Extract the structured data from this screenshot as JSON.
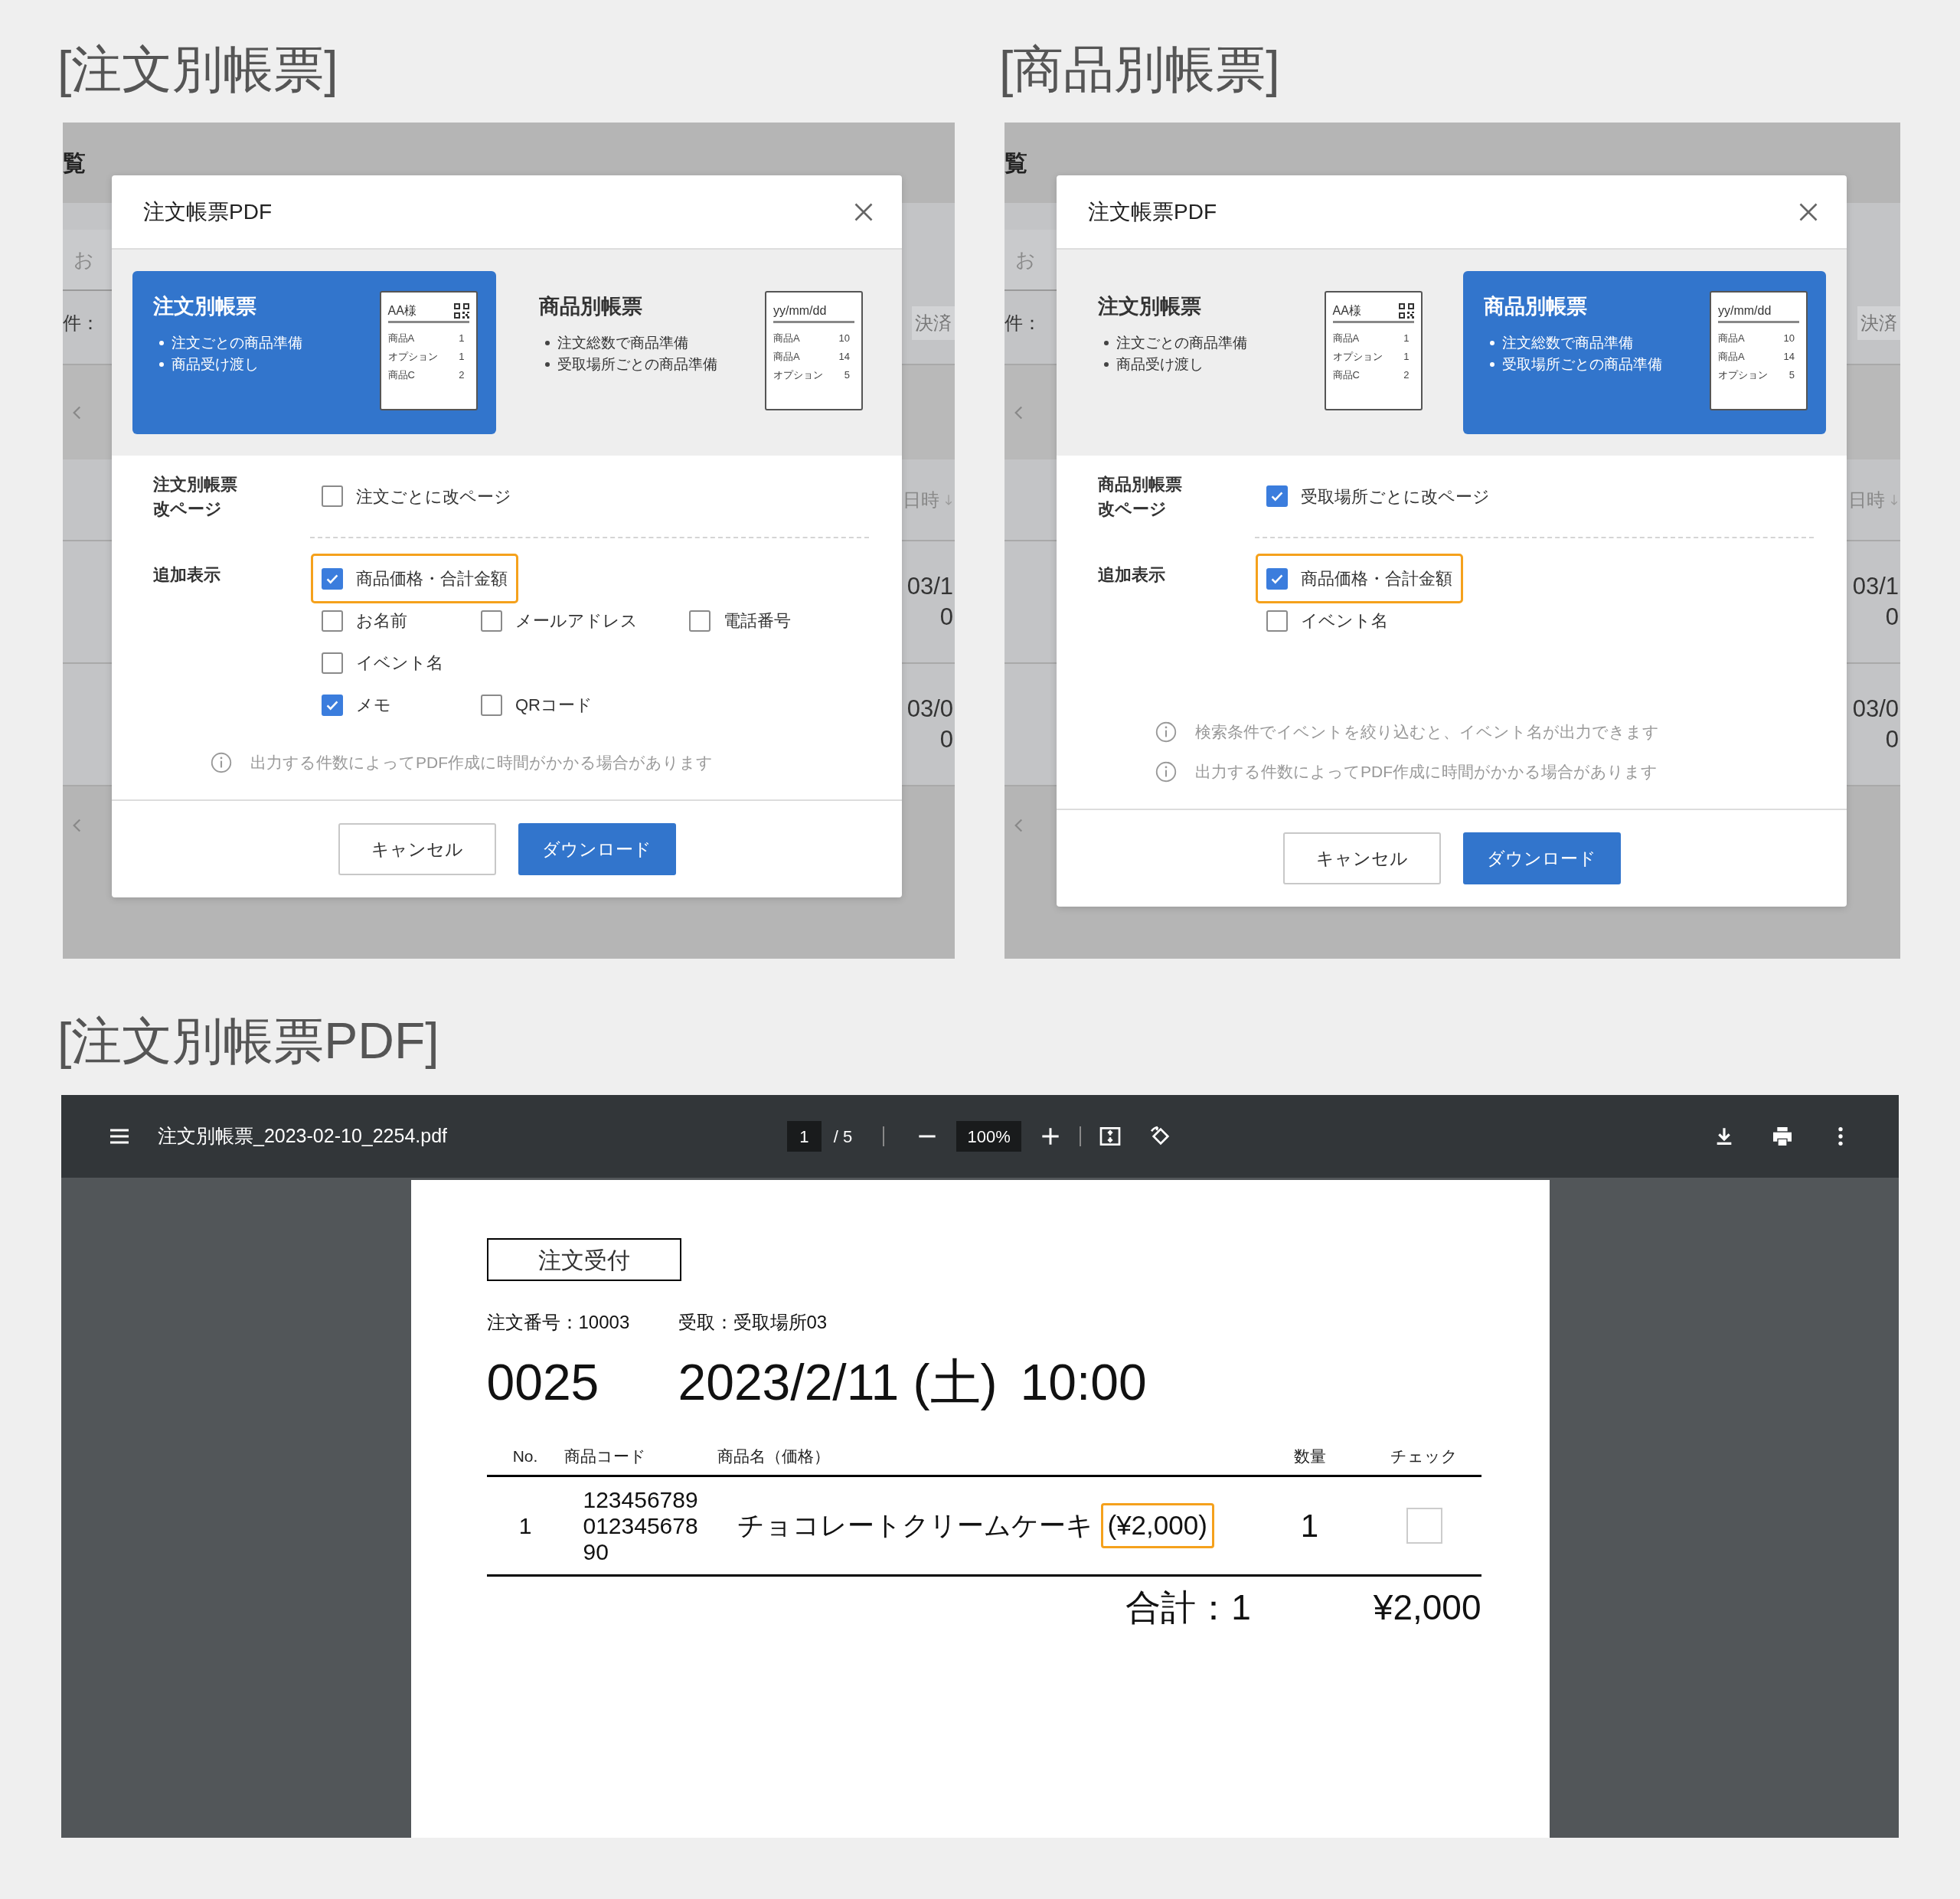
{
  "sections": [
    {
      "title": "[注文別帳票]",
      "backdrop": {
        "heading": "覧",
        "search_placeholder": "お",
        "filter_label": "件：",
        "filter_chip": "決済",
        "column_header": "日時",
        "rows": [
          [
            "03/1",
            "0"
          ],
          [
            "03/0",
            "0"
          ]
        ]
      },
      "dialog": {
        "title": "注文帳票PDF",
        "cards": [
          {
            "title": "注文別帳票",
            "selected": true,
            "bullets": [
              "注文ごとの商品準備",
              "商品受け渡し"
            ],
            "thumbnail": {
              "heading": "AA様",
              "kind": "order",
              "rows": [
                [
                  "商品A",
                  "1"
                ],
                [
                  "オプション",
                  "1"
                ],
                [
                  "商品C",
                  "2"
                ]
              ]
            }
          },
          {
            "title": "商品別帳票",
            "selected": false,
            "bullets": [
              "注文総数で商品準備",
              "受取場所ごとの商品準備"
            ],
            "thumbnail": {
              "heading": "yy/mm/dd",
              "kind": "product",
              "rows": [
                [
                  "商品A",
                  "10"
                ],
                [
                  "商品A",
                  "14"
                ],
                [
                  "オプション",
                  "5"
                ]
              ]
            }
          }
        ],
        "page_break": {
          "label": [
            "注文別帳票",
            "改ページ"
          ],
          "option": {
            "label": "注文ごとに改ページ",
            "checked": false
          }
        },
        "extra": {
          "label": "追加表示",
          "rows": [
            [
              {
                "label": "商品価格・合計金額",
                "checked": true,
                "highlighted": true
              }
            ],
            [
              {
                "label": "お名前",
                "checked": false,
                "highlighted": false
              },
              {
                "label": "メールアドレス",
                "checked": false,
                "highlighted": false
              },
              {
                "label": "電話番号",
                "checked": false,
                "highlighted": false
              }
            ],
            [
              {
                "label": "イベント名",
                "checked": false,
                "highlighted": false
              }
            ],
            [
              {
                "label": "メモ",
                "checked": true,
                "highlighted": false
              },
              {
                "label": "QRコード",
                "checked": false,
                "highlighted": false
              }
            ]
          ]
        },
        "notes": [
          "出力する件数によってPDF作成に時間がかかる場合があります"
        ],
        "buttons": [
          {
            "label": "キャンセル",
            "kind": "secondary"
          },
          {
            "label": "ダウンロード",
            "kind": "primary"
          }
        ]
      }
    },
    {
      "title": "[商品別帳票]",
      "backdrop": {
        "heading": "覧",
        "search_placeholder": "お",
        "filter_label": "件：",
        "filter_chip": "決済",
        "column_header": "日時",
        "rows": [
          [
            "03/1",
            "0"
          ],
          [
            "03/0",
            "0"
          ]
        ]
      },
      "dialog": {
        "title": "注文帳票PDF",
        "cards": [
          {
            "title": "注文別帳票",
            "selected": false,
            "bullets": [
              "注文ごとの商品準備",
              "商品受け渡し"
            ],
            "thumbnail": {
              "heading": "AA様",
              "kind": "order",
              "rows": [
                [
                  "商品A",
                  "1"
                ],
                [
                  "オプション",
                  "1"
                ],
                [
                  "商品C",
                  "2"
                ]
              ]
            }
          },
          {
            "title": "商品別帳票",
            "selected": true,
            "bullets": [
              "注文総数で商品準備",
              "受取場所ごとの商品準備"
            ],
            "thumbnail": {
              "heading": "yy/mm/dd",
              "kind": "product",
              "rows": [
                [
                  "商品A",
                  "10"
                ],
                [
                  "商品A",
                  "14"
                ],
                [
                  "オプション",
                  "5"
                ]
              ]
            }
          }
        ],
        "page_break": {
          "label": [
            "商品別帳票",
            "改ページ"
          ],
          "option": {
            "label": "受取場所ごとに改ページ",
            "checked": true
          }
        },
        "extra": {
          "label": "追加表示",
          "rows": [
            [
              {
                "label": "商品価格・合計金額",
                "checked": true,
                "highlighted": true
              }
            ],
            [
              {
                "label": "イベント名",
                "checked": false,
                "highlighted": false
              }
            ]
          ]
        },
        "notes": [
          "検索条件でイベントを絞り込むと、イベント名が出力できます",
          "出力する件数によってPDF作成に時間がかかる場合があります"
        ],
        "buttons": [
          {
            "label": "キャンセル",
            "kind": "secondary"
          },
          {
            "label": "ダウンロード",
            "kind": "primary"
          }
        ]
      }
    }
  ],
  "pdf_section": {
    "title": "[注文別帳票PDF]",
    "toolbar": {
      "filename": "注文別帳票_2023-02-10_2254.pdf",
      "page": "1",
      "page_total": "/ 5",
      "zoom": "100%"
    },
    "document": {
      "stamp": "注文受付",
      "order_no": "注文番号：10003",
      "pickup": "受取：受取場所03",
      "number": "0025",
      "date": "2023/2/11 (土)",
      "time": "10:00",
      "columns": [
        "No.",
        "商品コード",
        "商品名（価格）",
        "数量",
        "チェック"
      ],
      "rows": [
        {
          "no": "1",
          "code": "12345678901234567890",
          "name": "チョコレートクリームケーキ",
          "price": "(¥2,000)",
          "price_highlighted": true,
          "qty": "1",
          "checked": false
        }
      ],
      "total_label": "合計：1",
      "total_amount": "¥2,000"
    }
  }
}
